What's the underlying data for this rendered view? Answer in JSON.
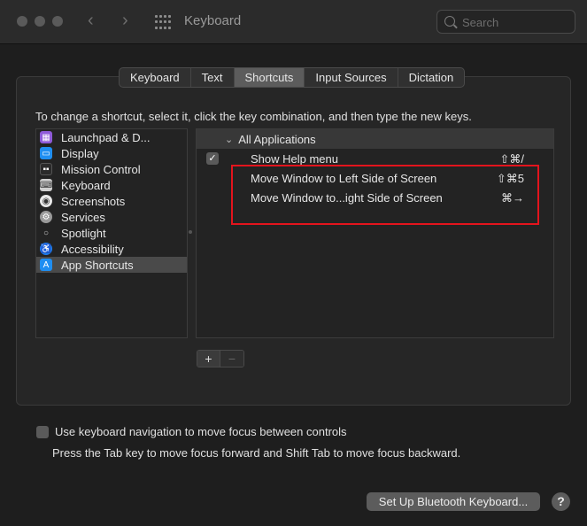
{
  "window": {
    "title": "Keyboard",
    "search_placeholder": "Search"
  },
  "tabs": [
    {
      "label": "Keyboard"
    },
    {
      "label": "Text"
    },
    {
      "label": "Shortcuts",
      "active": true
    },
    {
      "label": "Input Sources"
    },
    {
      "label": "Dictation"
    }
  ],
  "instructions": "To change a shortcut, select it, click the key combination, and then type the new keys.",
  "categories": [
    {
      "label": "Launchpad & D...",
      "icon": "launchpad-icon",
      "color": "#8e5ad8"
    },
    {
      "label": "Display",
      "icon": "display-icon",
      "color": "#1f8ef1"
    },
    {
      "label": "Mission Control",
      "icon": "mission-control-icon",
      "color": "#2a2a2a"
    },
    {
      "label": "Keyboard",
      "icon": "keyboard-icon",
      "color": "#cfcfcf"
    },
    {
      "label": "Screenshots",
      "icon": "screenshots-icon",
      "color": "#e8e8e8"
    },
    {
      "label": "Services",
      "icon": "services-icon",
      "color": "#9a9a9a"
    },
    {
      "label": "Spotlight",
      "icon": "spotlight-icon",
      "color": "#bdbdbd"
    },
    {
      "label": "Accessibility",
      "icon": "accessibility-icon",
      "color": "#1f7df1"
    },
    {
      "label": "App Shortcuts",
      "icon": "app-shortcuts-icon",
      "color": "#1f8ef1",
      "selected": true
    }
  ],
  "shortcuts": {
    "group_label": "All Applications",
    "rows": [
      {
        "label": "Show Help menu",
        "keys": "⇧⌘/",
        "checked": true
      },
      {
        "label": "Move Window to Left Side of Screen",
        "keys": "⇧⌘5",
        "checked": false
      },
      {
        "label": "Move Window to...ight Side of Screen",
        "keys": "⌘→",
        "checked": false
      }
    ]
  },
  "buttons": {
    "add": "+",
    "remove": "−",
    "bluetooth": "Set Up Bluetooth Keyboard...",
    "help": "?"
  },
  "keyboard_navigation": {
    "label": "Use keyboard navigation to move focus between controls",
    "checked": false,
    "hint": "Press the Tab key to move focus forward and Shift Tab to move focus backward."
  },
  "highlight_color": "#e3141d"
}
